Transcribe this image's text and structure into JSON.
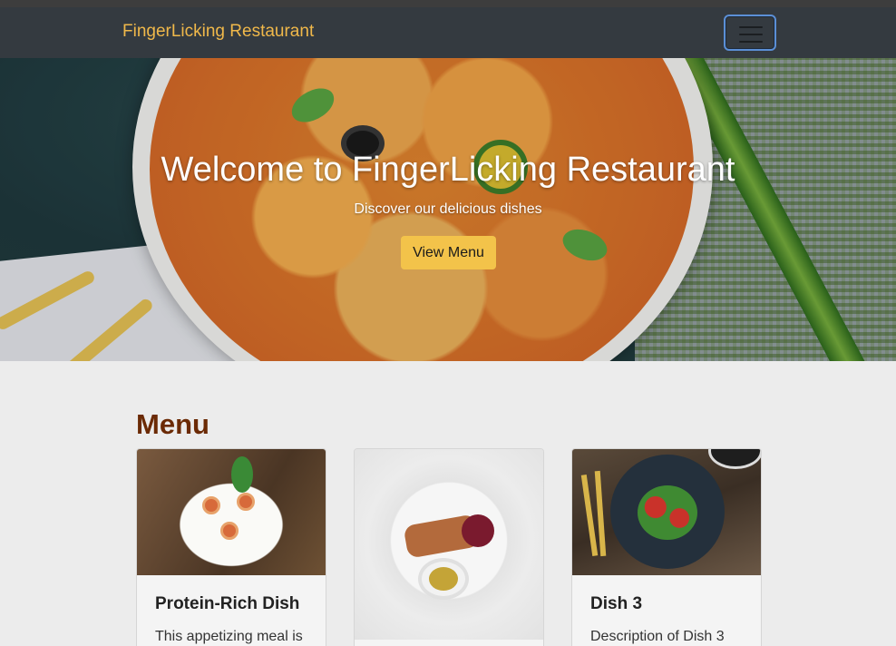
{
  "navbar": {
    "brand": "FingerLicking Restaurant",
    "toggler_icon": "hamburger-menu-icon"
  },
  "hero": {
    "title": "Welcome to FingerLicking Restaurant",
    "subtitle": "Discover our delicious dishes",
    "button_label": "View Menu"
  },
  "menu": {
    "heading": "Menu",
    "cards": [
      {
        "title": "Protein-Rich Dish",
        "text": "This appetizing meal is"
      },
      {
        "title": "",
        "text": ""
      },
      {
        "title": "Dish 3",
        "text": "Description of Dish 3"
      }
    ]
  },
  "colors": {
    "navbar_bg": "#343a40",
    "brand": "#f0b84a",
    "hero_button": "#f3c34a",
    "menu_heading": "#6b2a05",
    "toggler_border": "#5b8fd6"
  }
}
